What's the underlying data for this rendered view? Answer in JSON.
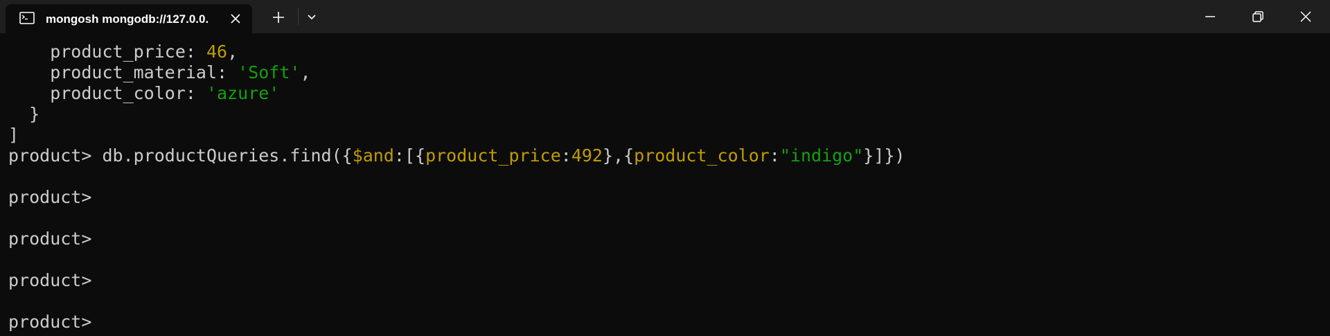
{
  "window": {
    "tab_title": "mongosh mongodb://127.0.0.",
    "icons": {
      "tab": "terminal-icon",
      "close": "close-icon",
      "new_tab": "plus-icon",
      "dropdown": "chevron-down-icon",
      "minimize": "minimize-icon",
      "maximize": "restore-icon",
      "window_close": "close-icon"
    }
  },
  "colors": {
    "background": "#0c0c0c",
    "titlebar": "#1f1f1f",
    "text": "#cccccc",
    "number": "#c19c00",
    "string": "#13a10e"
  },
  "terminal": {
    "l1_key": "    product_price: ",
    "l1_val": "46",
    "l1_end": ",",
    "l2_key": "    product_material: ",
    "l2_val": "'Soft'",
    "l2_end": ",",
    "l3_key": "    product_color: ",
    "l3_val": "'azure'",
    "l4": "  }",
    "l5": "]",
    "cmd_prompt": "product> ",
    "cmd_a": "db.productQueries.find({",
    "cmd_and": "$and",
    "cmd_b": ":[{",
    "cmd_price_key": "product_price",
    "cmd_c": ":",
    "cmd_price_val": "492",
    "cmd_d": "},{",
    "cmd_color_key": "product_color",
    "cmd_e": ":",
    "cmd_color_val": "\"indigo\"",
    "cmd_f": "}]})",
    "prompt1": "product>",
    "prompt2": "product>",
    "prompt3": "product>",
    "prompt4": "product>"
  }
}
